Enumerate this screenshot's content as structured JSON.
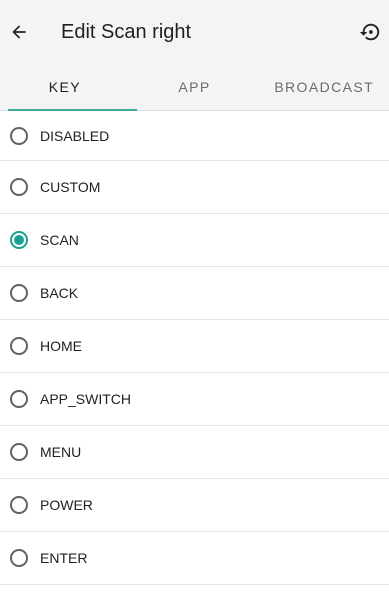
{
  "appbar": {
    "title": "Edit Scan right",
    "back_icon": "arrow-back-icon",
    "restore_icon": "restore-icon"
  },
  "tabs": [
    {
      "label": "KEY",
      "active": true
    },
    {
      "label": "APP",
      "active": false
    },
    {
      "label": "BROADCAST",
      "active": false
    }
  ],
  "options": [
    {
      "label": "DISABLED",
      "checked": false
    },
    {
      "label": "CUSTOM",
      "checked": false
    },
    {
      "label": "SCAN",
      "checked": true
    },
    {
      "label": "BACK",
      "checked": false
    },
    {
      "label": "HOME",
      "checked": false
    },
    {
      "label": "APP_SWITCH",
      "checked": false
    },
    {
      "label": "MENU",
      "checked": false
    },
    {
      "label": "POWER",
      "checked": false
    },
    {
      "label": "ENTER",
      "checked": false
    }
  ],
  "colors": {
    "accent": "#1aa195",
    "tab_indicator": "#3fa89a",
    "header_bg": "#f4f4f4"
  }
}
